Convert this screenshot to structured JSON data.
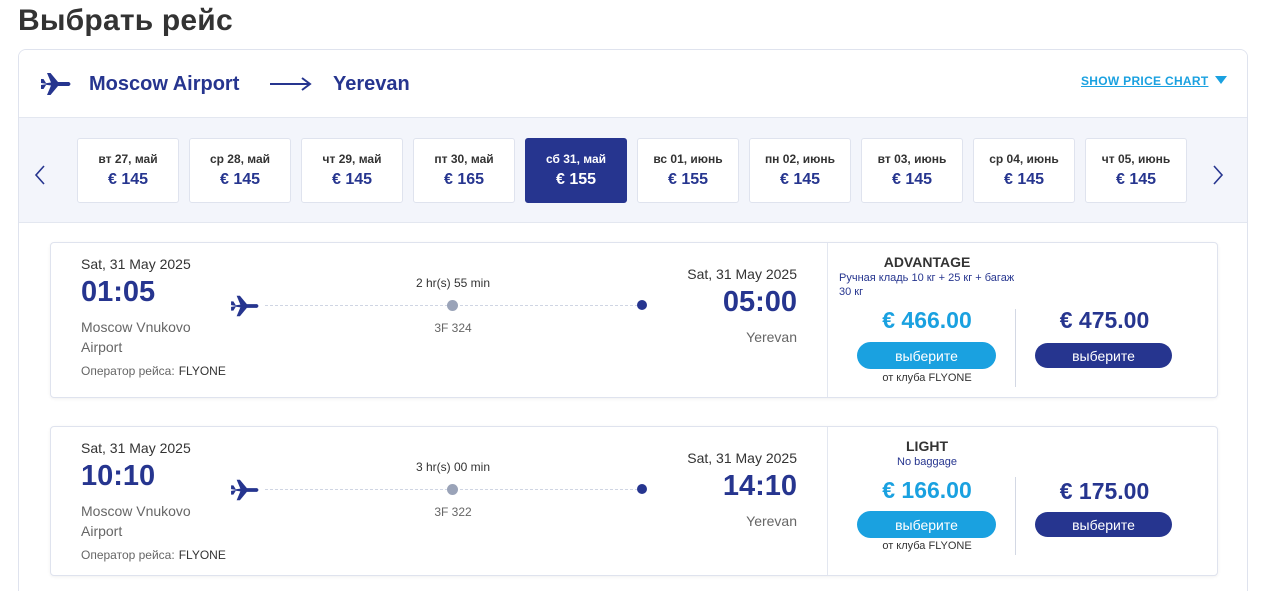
{
  "page_title": "Выбрать рейс",
  "route": {
    "from": "Moscow Airport",
    "to": "Yerevan",
    "price_chart_link": "SHOW PRICE CHART"
  },
  "dates": [
    {
      "label": "вт 27, май",
      "price": "€ 145",
      "selected": false
    },
    {
      "label": "ср 28, май",
      "price": "€ 145",
      "selected": false
    },
    {
      "label": "чт 29, май",
      "price": "€ 145",
      "selected": false
    },
    {
      "label": "пт 30, май",
      "price": "€ 165",
      "selected": false
    },
    {
      "label": "сб 31, май",
      "price": "€ 155",
      "selected": true
    },
    {
      "label": "вс 01, июнь",
      "price": "€ 155",
      "selected": false
    },
    {
      "label": "пн 02, июнь",
      "price": "€ 145",
      "selected": false
    },
    {
      "label": "вт 03, июнь",
      "price": "€ 145",
      "selected": false
    },
    {
      "label": "ср 04, июнь",
      "price": "€ 145",
      "selected": false
    },
    {
      "label": "чт 05, июнь",
      "price": "€ 145",
      "selected": false
    }
  ],
  "flights": [
    {
      "dep_date": "Sat, 31 May 2025",
      "dep_time": "01:05",
      "dep_airport": "Moscow Vnukovo Airport",
      "operator_label": "Оператор рейса:",
      "operator": "FLYONE",
      "duration": "2 hr(s) 55 min",
      "flight_no": "3F 324",
      "arr_date": "Sat, 31 May 2025",
      "arr_time": "05:00",
      "arr_city": "Yerevan",
      "fare": {
        "name": "ADVANTAGE",
        "description": "Ручная кладь 10 кг + 25 кг + багаж 30 кг",
        "club_price": "€ 466.00",
        "club_button": "выберите",
        "club_note": "от клуба FLYONE",
        "standard_price": "€ 475.00",
        "standard_button": "выберите"
      }
    },
    {
      "dep_date": "Sat, 31 May 2025",
      "dep_time": "10:10",
      "dep_airport": "Moscow Vnukovo Airport",
      "operator_label": "Оператор рейса:",
      "operator": "FLYONE",
      "duration": "3 hr(s) 00 min",
      "flight_no": "3F 322",
      "arr_date": "Sat, 31 May 2025",
      "arr_time": "14:10",
      "arr_city": "Yerevan",
      "fare": {
        "name": "LIGHT",
        "description": "No baggage",
        "club_price": "€ 166.00",
        "club_button": "выберите",
        "club_note": "от клуба FLYONE",
        "standard_price": "€ 175.00",
        "standard_button": "выберите"
      }
    }
  ],
  "icons": {
    "route": "plane-icon",
    "arrow": "arrow-right-icon",
    "prev": "chevron-left-icon",
    "next": "chevron-right-icon",
    "caret": "caret-down-icon"
  },
  "colors": {
    "brand_navy": "#26358f",
    "accent_blue": "#1aa1e0",
    "strip_bg": "#f3f5fb"
  }
}
